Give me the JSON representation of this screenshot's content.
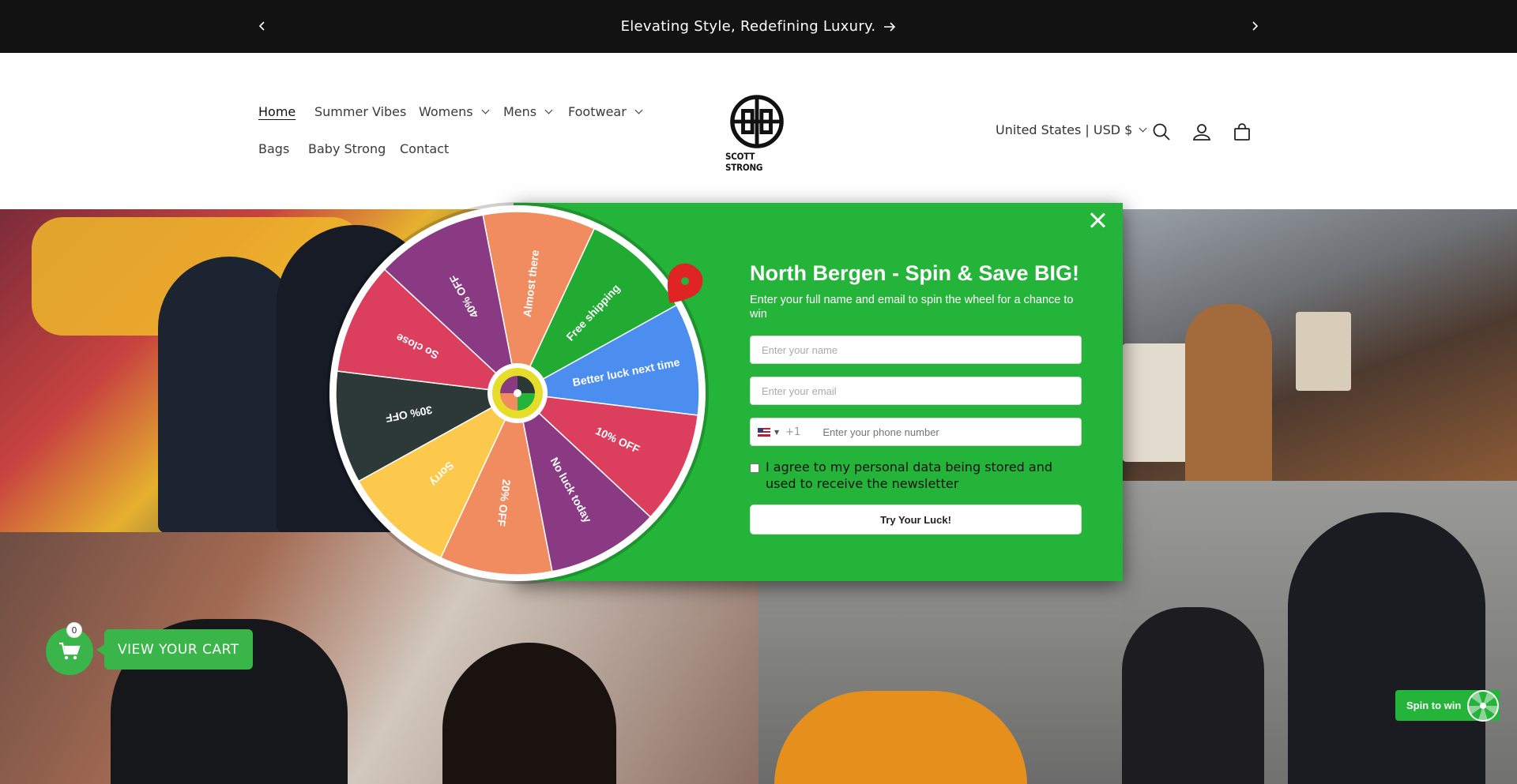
{
  "announcement": {
    "text": "Elevating Style, Redefining Luxury."
  },
  "nav": {
    "items": [
      {
        "label": "Home"
      },
      {
        "label": "Summer Vibes"
      },
      {
        "label": "Womens"
      },
      {
        "label": "Mens"
      },
      {
        "label": "Footwear"
      },
      {
        "label": "Bags"
      },
      {
        "label": "Baby Strong"
      },
      {
        "label": "Contact"
      }
    ]
  },
  "logo": {
    "name": "SCOTT STRONG"
  },
  "header": {
    "country": "United States | USD $"
  },
  "popup": {
    "title": "North Bergen - Spin & Save BIG!",
    "subtitle": "Enter your full name and email to spin the wheel for a chance to win",
    "name_placeholder": "Enter your name",
    "email_placeholder": "Enter your email",
    "phone_code": "+1",
    "phone_placeholder": "Enter your phone number",
    "agree_text": "I agree to my personal data being stored and used to receive the newsletter",
    "submit_label": "Try Your Luck!"
  },
  "wheel": {
    "segments": [
      {
        "label": "Almost there",
        "color": "#f08c5f"
      },
      {
        "label": "Free shipping",
        "color": "#22ab32"
      },
      {
        "label": "Better luck next time",
        "color": "#4c8ef0"
      },
      {
        "label": "10% OFF",
        "color": "#dc3f5e"
      },
      {
        "label": "No luck today",
        "color": "#8a3a82"
      },
      {
        "label": "20% OFF",
        "color": "#f08c5f"
      },
      {
        "label": "Sorry",
        "color": "#fcc94c"
      },
      {
        "label": "30% OFF",
        "color": "#2c3936"
      },
      {
        "label": "So close",
        "color": "#dc3f5e"
      },
      {
        "label": "40% OFF",
        "color": "#8a3a82"
      }
    ]
  },
  "cart": {
    "count": "0",
    "label": "VIEW YOUR CART"
  },
  "spin_widget": {
    "label": "Spin to win"
  },
  "colors": {
    "accent": "#25b43a",
    "announcement_bg": "#121212"
  }
}
